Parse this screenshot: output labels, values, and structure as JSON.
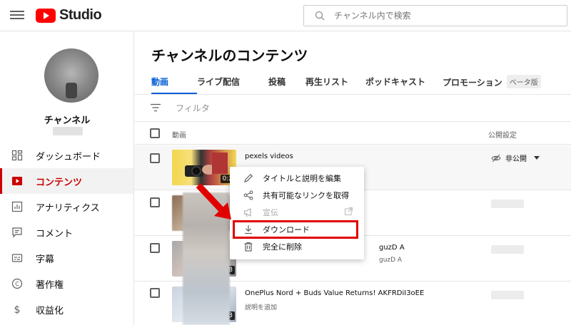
{
  "header": {
    "logo_text": "Studio",
    "search_placeholder": "チャンネル内で検索"
  },
  "sidebar": {
    "channel_name": "チャンネル",
    "items": [
      {
        "label": "ダッシュボード",
        "icon": "dashboard-icon"
      },
      {
        "label": "コンテンツ",
        "icon": "content-icon",
        "active": true
      },
      {
        "label": "アナリティクス",
        "icon": "analytics-icon"
      },
      {
        "label": "コメント",
        "icon": "comments-icon"
      },
      {
        "label": "字幕",
        "icon": "subtitles-icon"
      },
      {
        "label": "著作権",
        "icon": "copyright-icon"
      },
      {
        "label": "収益化",
        "icon": "monetization-icon"
      }
    ]
  },
  "main": {
    "title": "チャンネルのコンテンツ",
    "tabs": [
      "動画",
      "ライブ配信",
      "投稿",
      "再生リスト",
      "ポッドキャスト",
      "プロモーション"
    ],
    "beta_badge": "ベータ版",
    "filter_label": "フィルタ",
    "columns": {
      "video": "動画",
      "visibility": "公開設定"
    },
    "rows": [
      {
        "title": "pexels videos",
        "desc": "",
        "duration": "0:2",
        "visibility": "非公開"
      },
      {
        "title": "",
        "desc": "",
        "duration": "",
        "visibility": ""
      },
      {
        "title": "guzD A",
        "desc": "guzD A",
        "duration": "48",
        "visibility": ""
      },
      {
        "title": "OnePlus Nord + Buds Value Returns! AKFRDiI3oEE",
        "desc": "説明を追加",
        "duration": "3",
        "visibility": ""
      }
    ]
  },
  "context_menu": {
    "items": [
      {
        "label": "タイトルと説明を編集",
        "icon": "pencil-icon"
      },
      {
        "label": "共有可能なリンクを取得",
        "icon": "share-icon"
      },
      {
        "label": "宣伝",
        "icon": "megaphone-icon",
        "disabled": true
      },
      {
        "label": "ダウンロード",
        "icon": "download-icon"
      },
      {
        "label": "完全に削除",
        "icon": "trash-icon"
      }
    ]
  },
  "colors": {
    "accent_red": "#cc0000",
    "tab_blue": "#065fd4",
    "highlight_red": "#e00000"
  }
}
